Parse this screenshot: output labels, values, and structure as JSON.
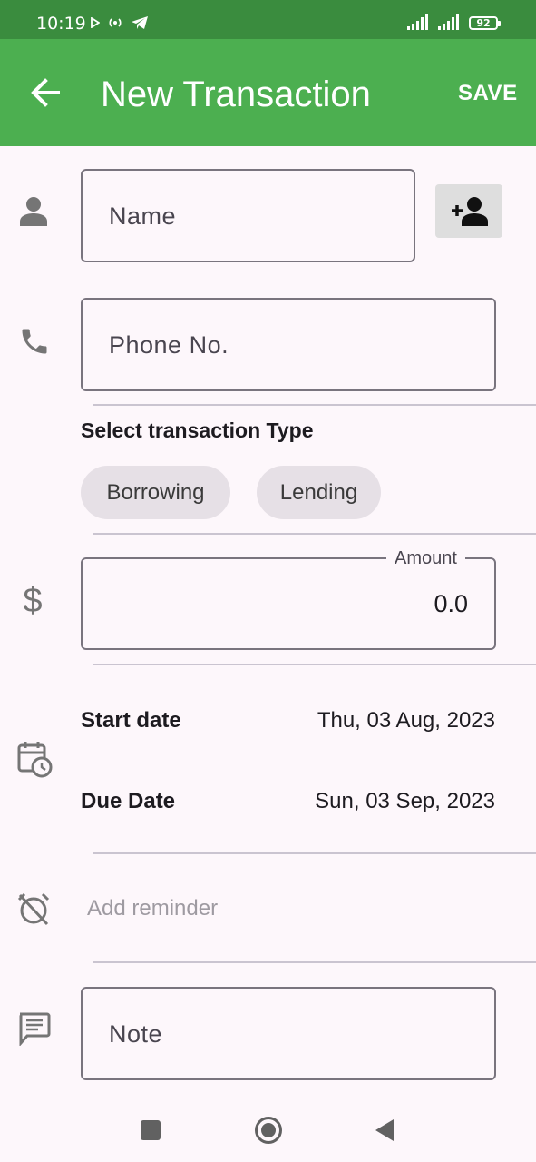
{
  "status_bar": {
    "time": "10:19",
    "battery": "92",
    "icons": [
      "play-icon",
      "radio-icon",
      "telegram-icon",
      "signal-icon",
      "signal-icon",
      "battery-icon"
    ]
  },
  "app_bar": {
    "title": "New Transaction",
    "save_label": "SAVE",
    "background": "#4caf50",
    "status_background": "#3a8c3e"
  },
  "form": {
    "name_placeholder": "Name",
    "phone_placeholder": "Phone No.",
    "transaction_type_label": "Select transaction Type",
    "transaction_types": [
      "Borrowing",
      "Lending"
    ],
    "amount_label": "Amount",
    "amount_value": "0.0",
    "start_date_label": "Start date",
    "start_date_value": "Thu, 03 Aug, 2023",
    "due_date_label": "Due Date",
    "due_date_value": "Sun, 03 Sep, 2023",
    "reminder_label": "Add reminder",
    "note_placeholder": "Note"
  },
  "nav_bar": {
    "icons": [
      "recents-icon",
      "home-icon",
      "back-icon"
    ]
  }
}
